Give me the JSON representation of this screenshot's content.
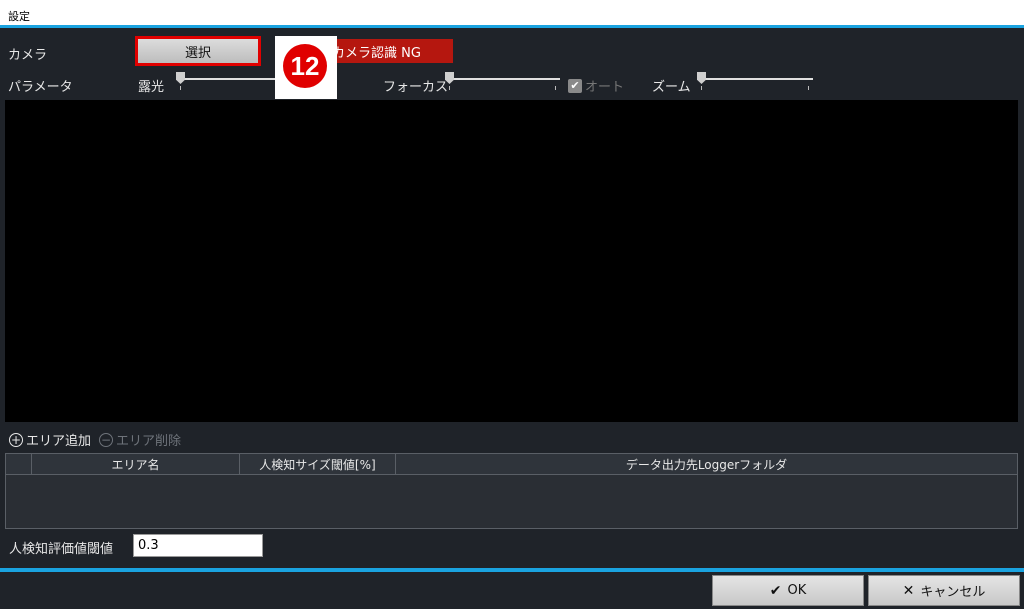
{
  "window": {
    "title": "設定"
  },
  "camera": {
    "label": "カメラ",
    "select_button": "選択",
    "status_text": "カメラ認識 NG",
    "status_color": "#b5170f"
  },
  "callout": {
    "number": "12"
  },
  "parameters": {
    "label": "パラメータ",
    "exposure_label": "露光",
    "focus_label": "フォーカス",
    "focus_auto_label": "オート",
    "focus_auto_checked": true,
    "zoom_label": "ズーム",
    "exposure_level": 0,
    "focus_level": 0,
    "zoom_level": 0
  },
  "areas": {
    "add_label": "エリア追加",
    "add_icon": "plus-circle-icon",
    "delete_label": "エリア削除",
    "delete_icon": "minus-circle-icon",
    "columns": [
      "エリア名",
      "人検知サイズ閾値[%]",
      "データ出力先Loggerフォルダ"
    ],
    "rows": []
  },
  "threshold": {
    "label": "人検知評価値閾値",
    "value": "0.3"
  },
  "footer": {
    "ok_label": "OK",
    "ok_icon": "check-icon",
    "cancel_label": "キャンセル",
    "cancel_icon": "x-icon"
  },
  "colors": {
    "accent": "#1aa3e0",
    "highlight": "#e00000"
  }
}
